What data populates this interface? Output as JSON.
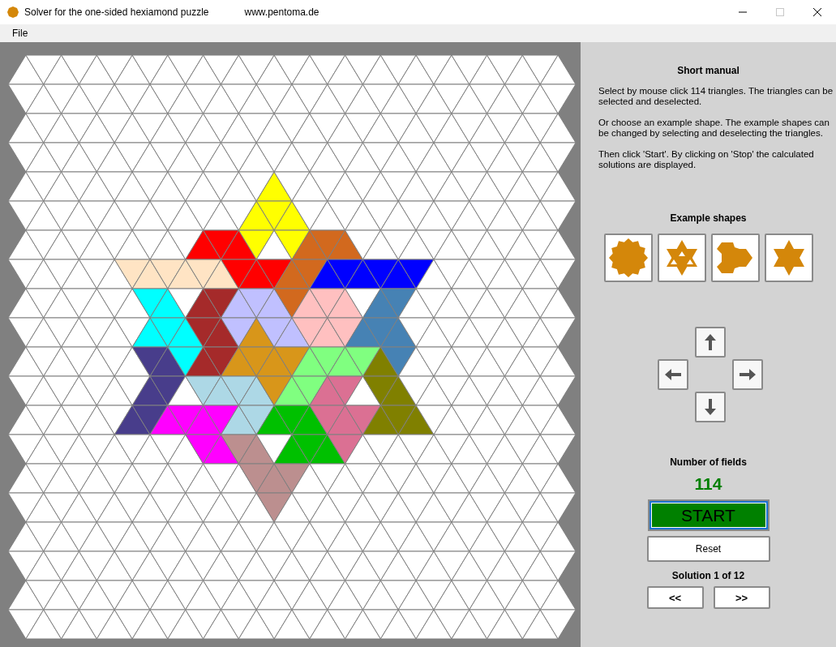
{
  "window": {
    "title": "Solver for the one-sided hexiamond puzzle",
    "subtitle": "www.pentoma.de"
  },
  "menu": [
    "File"
  ],
  "board": {
    "cells": [
      [
        {
          "selected": false
        },
        {
          "selected": false
        },
        {
          "selected": false
        },
        {
          "selected": false
        },
        {
          "selected": false
        },
        {
          "selected": false
        },
        {
          "selected": false
        },
        {
          "selected": false
        },
        {
          "selected": false
        },
        {
          "selected": false
        },
        {
          "selected": false
        },
        {
          "selected": false
        },
        {
          "selected": false
        },
        {
          "selected": false
        },
        {
          "selected": false
        },
        {
          "selected": false
        },
        {
          "selected": false
        },
        {
          "selected": false
        },
        {
          "selected": false
        },
        {
          "selected": false
        },
        {
          "selected": false
        },
        {
          "selected": false
        },
        {
          "selected": false
        },
        {
          "selected": false
        },
        {
          "selected": false
        },
        {
          "selected": false
        },
        {
          "selected": false
        },
        {
          "selected": false
        },
        {
          "selected": false
        },
        {
          "selected": false
        },
        {
          "selected": false
        }
      ],
      [
        {
          "selected": false
        },
        {
          "selected": false
        },
        {
          "selected": false
        },
        {
          "selected": false
        },
        {
          "selected": false
        },
        {
          "selected": false
        },
        {
          "selected": false
        },
        {
          "selected": false
        },
        {
          "selected": false
        },
        {
          "selected": false
        },
        {
          "selected": false
        },
        {
          "selected": false
        },
        {
          "selected": false
        },
        {
          "selected": false
        },
        {
          "selected": false
        },
        {
          "selected": false
        },
        {
          "selected": false
        },
        {
          "selected": false
        },
        {
          "selected": false
        },
        {
          "selected": false
        },
        {
          "selected": false
        },
        {
          "selected": false
        },
        {
          "selected": false
        },
        {
          "selected": false
        },
        {
          "selected": false
        },
        {
          "selected": false
        },
        {
          "selected": false
        },
        {
          "selected": false
        },
        {
          "selected": false
        },
        {
          "selected": false
        },
        {
          "selected": false
        }
      ],
      [
        {
          "selected": false
        },
        {
          "selected": false
        },
        {
          "selected": false
        },
        {
          "selected": false
        },
        {
          "selected": false
        },
        {
          "selected": false
        },
        {
          "selected": false
        },
        {
          "selected": false
        },
        {
          "selected": false
        },
        {
          "selected": false
        },
        {
          "selected": false
        },
        {
          "selected": false
        },
        {
          "selected": false
        },
        {
          "selected": false
        },
        {
          "selected": false
        },
        {
          "selected": false
        },
        {
          "selected": false
        },
        {
          "selected": false
        },
        {
          "selected": false
        },
        {
          "selected": false
        },
        {
          "selected": false
        },
        {
          "selected": false
        },
        {
          "selected": false
        },
        {
          "selected": false
        },
        {
          "selected": false
        },
        {
          "selected": false
        },
        {
          "selected": false
        },
        {
          "selected": false
        },
        {
          "selected": false
        },
        {
          "selected": false
        },
        {
          "selected": false
        }
      ],
      [
        {
          "selected": false
        },
        {
          "selected": false
        },
        {
          "selected": false
        },
        {
          "selected": false
        },
        {
          "selected": false
        },
        {
          "selected": false
        },
        {
          "selected": false
        },
        {
          "selected": false
        },
        {
          "selected": false
        },
        {
          "selected": false
        },
        {
          "selected": false
        },
        {
          "selected": false
        },
        {
          "selected": false
        },
        {
          "selected": false
        },
        {
          "selected": false
        },
        {
          "selected": false
        },
        {
          "selected": false
        },
        {
          "selected": false
        },
        {
          "selected": false
        },
        {
          "selected": false
        },
        {
          "selected": false
        },
        {
          "selected": false
        },
        {
          "selected": false
        },
        {
          "selected": false
        },
        {
          "selected": false
        },
        {
          "selected": false
        },
        {
          "selected": false
        },
        {
          "selected": false
        },
        {
          "selected": false
        },
        {
          "selected": false
        },
        {
          "selected": false
        }
      ],
      [
        {
          "selected": false
        },
        {
          "selected": false
        },
        {
          "selected": false
        },
        {
          "selected": false
        },
        {
          "selected": false
        },
        {
          "selected": false
        },
        {
          "selected": false
        },
        {
          "selected": false
        },
        {
          "selected": false
        },
        {
          "selected": false
        },
        {
          "selected": false
        },
        {
          "selected": false
        },
        {
          "selected": false
        },
        {
          "selected": false
        },
        {
          "selected": true,
          "color": "#ffff00"
        },
        {
          "selected": false
        },
        {
          "selected": false
        },
        {
          "selected": false
        },
        {
          "selected": false
        },
        {
          "selected": false
        },
        {
          "selected": false
        },
        {
          "selected": false
        },
        {
          "selected": false
        },
        {
          "selected": false
        },
        {
          "selected": false
        },
        {
          "selected": false
        },
        {
          "selected": false
        },
        {
          "selected": false
        },
        {
          "selected": false
        },
        {
          "selected": false
        },
        {
          "selected": false
        }
      ],
      [
        {
          "selected": false
        },
        {
          "selected": false
        },
        {
          "selected": false
        },
        {
          "selected": false
        },
        {
          "selected": false
        },
        {
          "selected": false
        },
        {
          "selected": false
        },
        {
          "selected": false
        },
        {
          "selected": false
        },
        {
          "selected": false
        },
        {
          "selected": false
        },
        {
          "selected": false
        },
        {
          "selected": false
        },
        {
          "selected": true,
          "color": "#ffff00"
        },
        {
          "selected": true,
          "color": "#ffff00"
        },
        {
          "selected": true,
          "color": "#ffff00"
        },
        {
          "selected": false
        },
        {
          "selected": false
        },
        {
          "selected": false
        },
        {
          "selected": false
        },
        {
          "selected": false
        },
        {
          "selected": false
        },
        {
          "selected": false
        },
        {
          "selected": false
        },
        {
          "selected": false
        },
        {
          "selected": false
        },
        {
          "selected": false
        },
        {
          "selected": false
        },
        {
          "selected": false
        },
        {
          "selected": false
        },
        {
          "selected": false
        }
      ],
      [
        {
          "selected": false
        },
        {
          "selected": false
        },
        {
          "selected": false
        },
        {
          "selected": false
        },
        {
          "selected": false
        },
        {
          "selected": false
        },
        {
          "selected": false
        },
        {
          "selected": false
        },
        {
          "selected": false
        },
        {
          "selected": false
        },
        {
          "selected": true,
          "color": "#ff0000"
        },
        {
          "selected": true,
          "color": "#ff0000"
        },
        {
          "selected": true,
          "color": "#ff0000"
        },
        {
          "selected": true,
          "color": "#ffff00"
        },
        {
          "selected": false
        },
        {
          "selected": true,
          "color": "#ffff00"
        },
        {
          "selected": true,
          "color": "#d2691e"
        },
        {
          "selected": true,
          "color": "#d2691e"
        },
        {
          "selected": true,
          "color": "#d2691e"
        },
        {
          "selected": false
        },
        {
          "selected": false
        },
        {
          "selected": false
        },
        {
          "selected": false
        },
        {
          "selected": false
        },
        {
          "selected": false
        },
        {
          "selected": false
        },
        {
          "selected": false
        },
        {
          "selected": false
        },
        {
          "selected": false
        },
        {
          "selected": false
        },
        {
          "selected": false
        }
      ],
      [
        {
          "selected": false
        },
        {
          "selected": false
        },
        {
          "selected": false
        },
        {
          "selected": false
        },
        {
          "selected": false
        },
        {
          "selected": false
        },
        {
          "selected": true,
          "color": "#ffe4c4"
        },
        {
          "selected": true,
          "color": "#ffe4c4"
        },
        {
          "selected": true,
          "color": "#ffe4c4"
        },
        {
          "selected": true,
          "color": "#ffe4c4"
        },
        {
          "selected": true,
          "color": "#ffe4c4"
        },
        {
          "selected": true,
          "color": "#ffe4c4"
        },
        {
          "selected": true,
          "color": "#ff0000"
        },
        {
          "selected": true,
          "color": "#ff0000"
        },
        {
          "selected": true,
          "color": "#ff0000"
        },
        {
          "selected": true,
          "color": "#d2691e"
        },
        {
          "selected": true,
          "color": "#d2691e"
        },
        {
          "selected": true,
          "color": "#0000ff"
        },
        {
          "selected": true,
          "color": "#0000ff"
        },
        {
          "selected": true,
          "color": "#0000ff"
        },
        {
          "selected": true,
          "color": "#0000ff"
        },
        {
          "selected": true,
          "color": "#0000ff"
        },
        {
          "selected": true,
          "color": "#0000ff"
        },
        {
          "selected": false
        },
        {
          "selected": false
        },
        {
          "selected": false
        },
        {
          "selected": false
        },
        {
          "selected": false
        },
        {
          "selected": false
        },
        {
          "selected": false
        },
        {
          "selected": false
        }
      ],
      [
        {
          "selected": false
        },
        {
          "selected": false
        },
        {
          "selected": false
        },
        {
          "selected": false
        },
        {
          "selected": false
        },
        {
          "selected": false
        },
        {
          "selected": false
        },
        {
          "selected": true,
          "color": "#00ffff"
        },
        {
          "selected": true,
          "color": "#00ffff"
        },
        {
          "selected": false
        },
        {
          "selected": true,
          "color": "#a52a2a"
        },
        {
          "selected": true,
          "color": "#a52a2a"
        },
        {
          "selected": true,
          "color": "#c0c0ff"
        },
        {
          "selected": true,
          "color": "#c0c0ff"
        },
        {
          "selected": true,
          "color": "#c0c0ff"
        },
        {
          "selected": true,
          "color": "#d2691e"
        },
        {
          "selected": true,
          "color": "#ffc0c0"
        },
        {
          "selected": true,
          "color": "#ffc0c0"
        },
        {
          "selected": true,
          "color": "#ffc0c0"
        },
        {
          "selected": false
        },
        {
          "selected": true,
          "color": "#4682b4"
        },
        {
          "selected": true,
          "color": "#4682b4"
        },
        {
          "selected": false
        },
        {
          "selected": false
        },
        {
          "selected": false
        },
        {
          "selected": false
        },
        {
          "selected": false
        },
        {
          "selected": false
        },
        {
          "selected": false
        },
        {
          "selected": false
        },
        {
          "selected": false
        }
      ],
      [
        {
          "selected": false
        },
        {
          "selected": false
        },
        {
          "selected": false
        },
        {
          "selected": false
        },
        {
          "selected": false
        },
        {
          "selected": false
        },
        {
          "selected": false
        },
        {
          "selected": true,
          "color": "#00ffff"
        },
        {
          "selected": true,
          "color": "#00ffff"
        },
        {
          "selected": true,
          "color": "#00ffff"
        },
        {
          "selected": true,
          "color": "#a52a2a"
        },
        {
          "selected": true,
          "color": "#a52a2a"
        },
        {
          "selected": true,
          "color": "#c0c0ff"
        },
        {
          "selected": true,
          "color": "#d8961a"
        },
        {
          "selected": true,
          "color": "#c0c0ff"
        },
        {
          "selected": true,
          "color": "#c0c0ff"
        },
        {
          "selected": true,
          "color": "#ffc0c0"
        },
        {
          "selected": true,
          "color": "#ffc0c0"
        },
        {
          "selected": true,
          "color": "#ffc0c0"
        },
        {
          "selected": true,
          "color": "#4682b4"
        },
        {
          "selected": true,
          "color": "#4682b4"
        },
        {
          "selected": true,
          "color": "#4682b4"
        },
        {
          "selected": false
        },
        {
          "selected": false
        },
        {
          "selected": false
        },
        {
          "selected": false
        },
        {
          "selected": false
        },
        {
          "selected": false
        },
        {
          "selected": false
        },
        {
          "selected": false
        },
        {
          "selected": false
        }
      ],
      [
        {
          "selected": false
        },
        {
          "selected": false
        },
        {
          "selected": false
        },
        {
          "selected": false
        },
        {
          "selected": false
        },
        {
          "selected": false
        },
        {
          "selected": false
        },
        {
          "selected": true,
          "color": "#483d8b"
        },
        {
          "selected": true,
          "color": "#483d8b"
        },
        {
          "selected": true,
          "color": "#00ffff"
        },
        {
          "selected": true,
          "color": "#a52a2a"
        },
        {
          "selected": true,
          "color": "#a52a2a"
        },
        {
          "selected": true,
          "color": "#d8961a"
        },
        {
          "selected": true,
          "color": "#d8961a"
        },
        {
          "selected": true,
          "color": "#d8961a"
        },
        {
          "selected": true,
          "color": "#d8961a"
        },
        {
          "selected": true,
          "color": "#80ff80"
        },
        {
          "selected": true,
          "color": "#80ff80"
        },
        {
          "selected": true,
          "color": "#80ff80"
        },
        {
          "selected": true,
          "color": "#80ff80"
        },
        {
          "selected": true,
          "color": "#808000"
        },
        {
          "selected": true,
          "color": "#4682b4"
        },
        {
          "selected": false
        },
        {
          "selected": false
        },
        {
          "selected": false
        },
        {
          "selected": false
        },
        {
          "selected": false
        },
        {
          "selected": false
        },
        {
          "selected": false
        },
        {
          "selected": false
        },
        {
          "selected": false
        }
      ],
      [
        {
          "selected": false
        },
        {
          "selected": false
        },
        {
          "selected": false
        },
        {
          "selected": false
        },
        {
          "selected": false
        },
        {
          "selected": false
        },
        {
          "selected": false
        },
        {
          "selected": true,
          "color": "#483d8b"
        },
        {
          "selected": true,
          "color": "#483d8b"
        },
        {
          "selected": false
        },
        {
          "selected": true,
          "color": "#add8e6"
        },
        {
          "selected": true,
          "color": "#add8e6"
        },
        {
          "selected": true,
          "color": "#add8e6"
        },
        {
          "selected": true,
          "color": "#add8e6"
        },
        {
          "selected": true,
          "color": "#d8961a"
        },
        {
          "selected": true,
          "color": "#80ff80"
        },
        {
          "selected": true,
          "color": "#80ff80"
        },
        {
          "selected": true,
          "color": "#db7093"
        },
        {
          "selected": true,
          "color": "#db7093"
        },
        {
          "selected": false
        },
        {
          "selected": true,
          "color": "#808000"
        },
        {
          "selected": true,
          "color": "#808000"
        },
        {
          "selected": false
        },
        {
          "selected": false
        },
        {
          "selected": false
        },
        {
          "selected": false
        },
        {
          "selected": false
        },
        {
          "selected": false
        },
        {
          "selected": false
        },
        {
          "selected": false
        },
        {
          "selected": false
        }
      ],
      [
        {
          "selected": false
        },
        {
          "selected": false
        },
        {
          "selected": false
        },
        {
          "selected": false
        },
        {
          "selected": false
        },
        {
          "selected": false
        },
        {
          "selected": true,
          "color": "#483d8b"
        },
        {
          "selected": true,
          "color": "#483d8b"
        },
        {
          "selected": true,
          "color": "#ff00ff"
        },
        {
          "selected": true,
          "color": "#ff00ff"
        },
        {
          "selected": true,
          "color": "#ff00ff"
        },
        {
          "selected": true,
          "color": "#ff00ff"
        },
        {
          "selected": true,
          "color": "#add8e6"
        },
        {
          "selected": true,
          "color": "#add8e6"
        },
        {
          "selected": true,
          "color": "#00c000"
        },
        {
          "selected": true,
          "color": "#00c000"
        },
        {
          "selected": true,
          "color": "#00c000"
        },
        {
          "selected": true,
          "color": "#db7093"
        },
        {
          "selected": true,
          "color": "#db7093"
        },
        {
          "selected": true,
          "color": "#db7093"
        },
        {
          "selected": true,
          "color": "#808000"
        },
        {
          "selected": true,
          "color": "#808000"
        },
        {
          "selected": true,
          "color": "#808000"
        },
        {
          "selected": false
        },
        {
          "selected": false
        },
        {
          "selected": false
        },
        {
          "selected": false
        },
        {
          "selected": false
        },
        {
          "selected": false
        },
        {
          "selected": false
        },
        {
          "selected": false
        }
      ],
      [
        {
          "selected": false
        },
        {
          "selected": false
        },
        {
          "selected": false
        },
        {
          "selected": false
        },
        {
          "selected": false
        },
        {
          "selected": false
        },
        {
          "selected": false
        },
        {
          "selected": false
        },
        {
          "selected": false
        },
        {
          "selected": false
        },
        {
          "selected": true,
          "color": "#ff00ff"
        },
        {
          "selected": true,
          "color": "#ff00ff"
        },
        {
          "selected": true,
          "color": "#bc8f8f"
        },
        {
          "selected": true,
          "color": "#bc8f8f"
        },
        {
          "selected": false
        },
        {
          "selected": true,
          "color": "#00c000"
        },
        {
          "selected": true,
          "color": "#00c000"
        },
        {
          "selected": true,
          "color": "#00c000"
        },
        {
          "selected": true,
          "color": "#db7093"
        },
        {
          "selected": false
        },
        {
          "selected": false
        },
        {
          "selected": false
        },
        {
          "selected": false
        },
        {
          "selected": false
        },
        {
          "selected": false
        },
        {
          "selected": false
        },
        {
          "selected": false
        },
        {
          "selected": false
        },
        {
          "selected": false
        },
        {
          "selected": false
        },
        {
          "selected": false
        }
      ],
      [
        {
          "selected": false
        },
        {
          "selected": false
        },
        {
          "selected": false
        },
        {
          "selected": false
        },
        {
          "selected": false
        },
        {
          "selected": false
        },
        {
          "selected": false
        },
        {
          "selected": false
        },
        {
          "selected": false
        },
        {
          "selected": false
        },
        {
          "selected": false
        },
        {
          "selected": false
        },
        {
          "selected": false
        },
        {
          "selected": true,
          "color": "#bc8f8f"
        },
        {
          "selected": true,
          "color": "#bc8f8f"
        },
        {
          "selected": true,
          "color": "#bc8f8f"
        },
        {
          "selected": false
        },
        {
          "selected": false
        },
        {
          "selected": false
        },
        {
          "selected": false
        },
        {
          "selected": false
        },
        {
          "selected": false
        },
        {
          "selected": false
        },
        {
          "selected": false
        },
        {
          "selected": false
        },
        {
          "selected": false
        },
        {
          "selected": false
        },
        {
          "selected": false
        },
        {
          "selected": false
        },
        {
          "selected": false
        },
        {
          "selected": false
        }
      ],
      [
        {
          "selected": false
        },
        {
          "selected": false
        },
        {
          "selected": false
        },
        {
          "selected": false
        },
        {
          "selected": false
        },
        {
          "selected": false
        },
        {
          "selected": false
        },
        {
          "selected": false
        },
        {
          "selected": false
        },
        {
          "selected": false
        },
        {
          "selected": false
        },
        {
          "selected": false
        },
        {
          "selected": false
        },
        {
          "selected": false
        },
        {
          "selected": true,
          "color": "#bc8f8f"
        },
        {
          "selected": false
        },
        {
          "selected": false
        },
        {
          "selected": false
        },
        {
          "selected": false
        },
        {
          "selected": false
        },
        {
          "selected": false
        },
        {
          "selected": false
        },
        {
          "selected": false
        },
        {
          "selected": false
        },
        {
          "selected": false
        },
        {
          "selected": false
        },
        {
          "selected": false
        },
        {
          "selected": false
        },
        {
          "selected": false
        },
        {
          "selected": false
        },
        {
          "selected": false
        }
      ],
      [
        {
          "selected": false
        },
        {
          "selected": false
        },
        {
          "selected": false
        },
        {
          "selected": false
        },
        {
          "selected": false
        },
        {
          "selected": false
        },
        {
          "selected": false
        },
        {
          "selected": false
        },
        {
          "selected": false
        },
        {
          "selected": false
        },
        {
          "selected": false
        },
        {
          "selected": false
        },
        {
          "selected": false
        },
        {
          "selected": false
        },
        {
          "selected": false
        },
        {
          "selected": false
        },
        {
          "selected": false
        },
        {
          "selected": false
        },
        {
          "selected": false
        },
        {
          "selected": false
        },
        {
          "selected": false
        },
        {
          "selected": false
        },
        {
          "selected": false
        },
        {
          "selected": false
        },
        {
          "selected": false
        },
        {
          "selected": false
        },
        {
          "selected": false
        },
        {
          "selected": false
        },
        {
          "selected": false
        },
        {
          "selected": false
        },
        {
          "selected": false
        }
      ],
      [
        {
          "selected": false
        },
        {
          "selected": false
        },
        {
          "selected": false
        },
        {
          "selected": false
        },
        {
          "selected": false
        },
        {
          "selected": false
        },
        {
          "selected": false
        },
        {
          "selected": false
        },
        {
          "selected": false
        },
        {
          "selected": false
        },
        {
          "selected": false
        },
        {
          "selected": false
        },
        {
          "selected": false
        },
        {
          "selected": false
        },
        {
          "selected": false
        },
        {
          "selected": false
        },
        {
          "selected": false
        },
        {
          "selected": false
        },
        {
          "selected": false
        },
        {
          "selected": false
        },
        {
          "selected": false
        },
        {
          "selected": false
        },
        {
          "selected": false
        },
        {
          "selected": false
        },
        {
          "selected": false
        },
        {
          "selected": false
        },
        {
          "selected": false
        },
        {
          "selected": false
        },
        {
          "selected": false
        },
        {
          "selected": false
        },
        {
          "selected": false
        }
      ],
      [
        {
          "selected": false
        },
        {
          "selected": false
        },
        {
          "selected": false
        },
        {
          "selected": false
        },
        {
          "selected": false
        },
        {
          "selected": false
        },
        {
          "selected": false
        },
        {
          "selected": false
        },
        {
          "selected": false
        },
        {
          "selected": false
        },
        {
          "selected": false
        },
        {
          "selected": false
        },
        {
          "selected": false
        },
        {
          "selected": false
        },
        {
          "selected": false
        },
        {
          "selected": false
        },
        {
          "selected": false
        },
        {
          "selected": false
        },
        {
          "selected": false
        },
        {
          "selected": false
        },
        {
          "selected": false
        },
        {
          "selected": false
        },
        {
          "selected": false
        },
        {
          "selected": false
        },
        {
          "selected": false
        },
        {
          "selected": false
        },
        {
          "selected": false
        },
        {
          "selected": false
        },
        {
          "selected": false
        },
        {
          "selected": false
        },
        {
          "selected": false
        }
      ],
      [
        {
          "selected": false
        },
        {
          "selected": false
        },
        {
          "selected": false
        },
        {
          "selected": false
        },
        {
          "selected": false
        },
        {
          "selected": false
        },
        {
          "selected": false
        },
        {
          "selected": false
        },
        {
          "selected": false
        },
        {
          "selected": false
        },
        {
          "selected": false
        },
        {
          "selected": false
        },
        {
          "selected": false
        },
        {
          "selected": false
        },
        {
          "selected": false
        },
        {
          "selected": false
        },
        {
          "selected": false
        },
        {
          "selected": false
        },
        {
          "selected": false
        },
        {
          "selected": false
        },
        {
          "selected": false
        },
        {
          "selected": false
        },
        {
          "selected": false
        },
        {
          "selected": false
        },
        {
          "selected": false
        },
        {
          "selected": false
        },
        {
          "selected": false
        },
        {
          "selected": false
        },
        {
          "selected": false
        },
        {
          "selected": false
        },
        {
          "selected": false
        }
      ]
    ]
  },
  "manual": {
    "title": "Short manual",
    "paragraphs": [
      "Select by mouse click 114 triangles. The triangles can be selected and deselected.",
      "Or choose an example shape. The example shapes can be changed by selecting and deselecting the triangles.",
      "Then click 'Start'. By clicking on 'Stop' the calculated solutions are displayed."
    ]
  },
  "examples": {
    "title": "Example shapes",
    "shapes": [
      {
        "kind": "flower"
      },
      {
        "kind": "star-holes"
      },
      {
        "kind": "trilobe"
      },
      {
        "kind": "hexagram"
      }
    ]
  },
  "arrows": [
    {
      "kind": "up"
    },
    {
      "kind": "left"
    },
    {
      "kind": "right"
    },
    {
      "kind": "down"
    }
  ],
  "fields": {
    "label": "Number of fields",
    "value": "114"
  },
  "buttons": {
    "start": "START",
    "reset": "Reset",
    "prev": "<<",
    "next": ">>"
  },
  "solution": "Solution 1 of 12"
}
